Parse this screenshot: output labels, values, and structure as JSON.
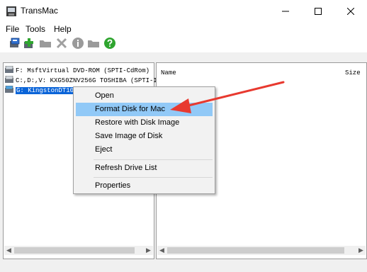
{
  "window": {
    "title": "TransMac"
  },
  "menu": [
    "File",
    "Tools",
    "Help"
  ],
  "toolbar": {
    "icons": [
      "format-disk-icon",
      "restore-image-icon",
      "folder-icon",
      "delete-icon",
      "info-icon",
      "folder-open-icon",
      "help-icon"
    ]
  },
  "drives": [
    "F: MsftVirtual DVD-ROM (SPTI-CdRom)",
    "C:,D:,V: KXG50ZNV256G TOSHIBA (SPTI-I",
    "G: KingstonDT10"
  ],
  "file_list": {
    "columns": [
      "Name",
      "Size"
    ]
  },
  "context_menu": {
    "items": [
      "Open",
      "Format Disk for Mac",
      "Restore with Disk Image",
      "Save Image of Disk",
      "Eject",
      "Refresh Drive List",
      "Properties"
    ],
    "highlighted": "Format Disk for Mac"
  },
  "colors": {
    "selection": "#0a64d8",
    "highlight": "#91c9f7",
    "annotation_arrow": "#e8392f"
  }
}
